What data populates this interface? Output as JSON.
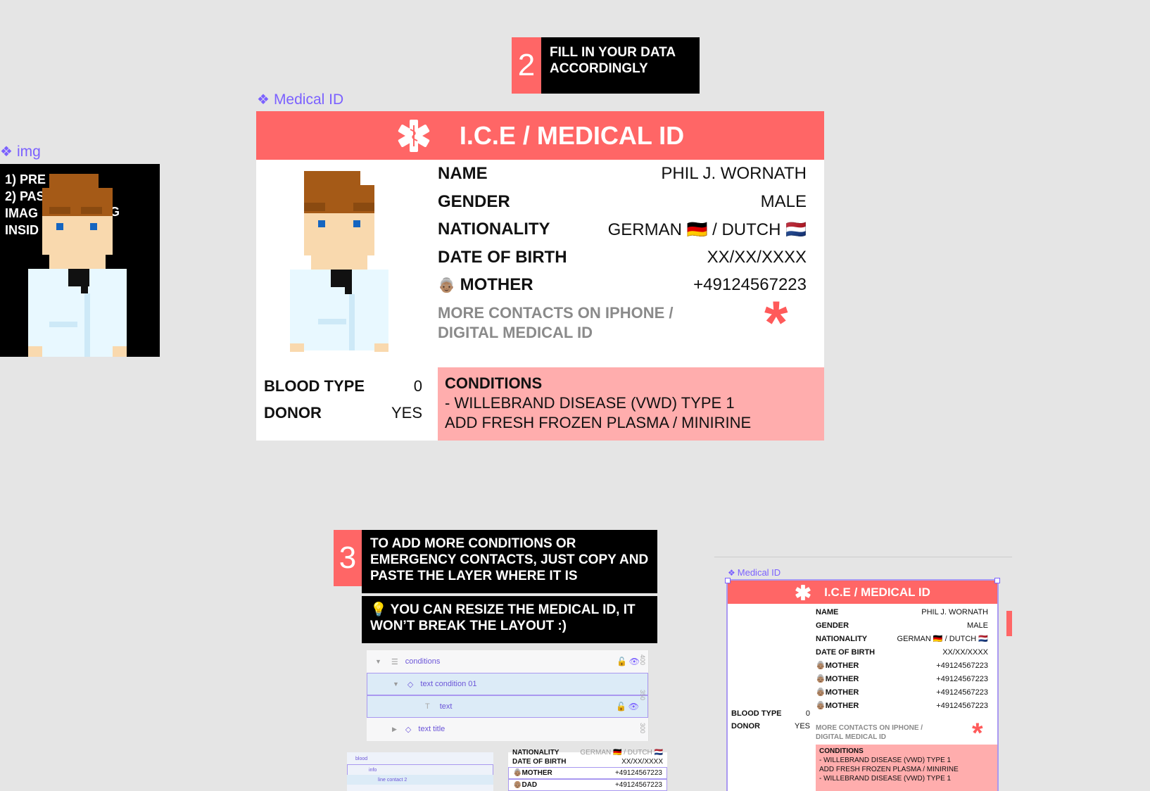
{
  "step2": {
    "num": "2",
    "text": "FILL IN YOUR DATA ACCORDINGLY"
  },
  "step3": {
    "num": "3",
    "text": "TO ADD MORE CONDITIONS OR EMERGENCY CONTACTS, JUST COPY AND PASTE THE LAYER WHERE IT IS"
  },
  "tip": {
    "icon": "💡",
    "text": "YOU CAN RESIZE THE MEDICAL ID, IT WON’T BREAK THE LAYOUT :)"
  },
  "img_frame": {
    "label": "img",
    "instructions": [
      "1) PRE",
      "2) PAS",
      "IMAG",
      "INSID",
      "G"
    ]
  },
  "card": {
    "frame_label": "Medical ID",
    "title": "I.C.E / MEDICAL ID",
    "fields": [
      {
        "label": "NAME",
        "value": "PHIL J. WORNATH"
      },
      {
        "label": "GENDER",
        "value": "MALE"
      },
      {
        "label": "NATIONALITY",
        "value": "GERMAN 🇩🇪 / DUTCH 🇳🇱"
      },
      {
        "label": "DATE OF BIRTH",
        "value": "XX/XX/XXXX"
      },
      {
        "label": "MOTHER",
        "value": "+49124567223",
        "icon": "👵🏽"
      }
    ],
    "more_contacts": "MORE CONTACTS ON IPHONE / DIGITAL MEDICAL ID",
    "star": "*",
    "blood_type_label": "BLOOD TYPE",
    "blood_type_value": "0",
    "donor_label": "DONOR",
    "donor_value": "YES",
    "conditions_title": "CONDITIONS",
    "conditions_lines": [
      "- WILLEBRAND DISEASE (VWD) TYPE 1",
      "ADD FRESH FROZEN PLASMA / MINIRINE"
    ]
  },
  "layers_panel": {
    "rows": [
      {
        "label": "conditions",
        "icon": "frame"
      },
      {
        "label": "text condition 01",
        "icon": "component"
      },
      {
        "label": "text",
        "icon": "text"
      },
      {
        "label": "text title",
        "icon": "component"
      }
    ],
    "ruler": [
      "400",
      "350",
      "300"
    ]
  },
  "small_layers": {
    "rows": [
      "blood",
      "info",
      "line contact 2"
    ]
  },
  "small_preview": {
    "rows": [
      {
        "label": "NATIONALITY",
        "value": "GERMAN 🇩🇪 / DUTCH 🇳🇱"
      },
      {
        "label": "DATE OF BIRTH",
        "value": "XX/XX/XXXX"
      },
      {
        "label": "MOTHER",
        "value": "+49124567223",
        "icon": "👵🏽"
      },
      {
        "label": "DAD",
        "value": "+49124567223",
        "icon": "👴🏽"
      }
    ]
  },
  "card_small": {
    "frame_label": "Medical ID",
    "title": "I.C.E / MEDICAL ID",
    "fields": [
      {
        "label": "NAME",
        "value": "PHIL J. WORNATH"
      },
      {
        "label": "GENDER",
        "value": "MALE"
      },
      {
        "label": "NATIONALITY",
        "value": "GERMAN 🇩🇪 / DUTCH 🇳🇱"
      },
      {
        "label": "DATE OF BIRTH",
        "value": "XX/XX/XXXX"
      },
      {
        "label": "MOTHER",
        "value": "+49124567223",
        "icon": "👵🏽"
      },
      {
        "label": "MOTHER",
        "value": "+49124567223",
        "icon": "👵🏽"
      },
      {
        "label": "MOTHER",
        "value": "+49124567223",
        "icon": "👵🏽"
      },
      {
        "label": "MOTHER",
        "value": "+49124567223",
        "icon": "👵🏽"
      }
    ],
    "blood_type_label": "BLOOD TYPE",
    "blood_type_value": "0",
    "donor_label": "DONOR",
    "donor_value": "YES",
    "more_contacts": "MORE CONTACTS ON IPHONE / DIGITAL MEDICAL ID",
    "star": "*",
    "conditions_title": "CONDITIONS",
    "conditions_lines": [
      "- WILLEBRAND DISEASE (VWD) TYPE 1",
      "ADD FRESH FROZEN PLASMA / MINIRINE",
      "- WILLEBRAND DISEASE (VWD) TYPE 1"
    ]
  },
  "colors": {
    "accent": "#ff6666",
    "conditions": "#ffadad",
    "figma_purple": "#7b61ff",
    "canvas": "#e5e5e5"
  }
}
